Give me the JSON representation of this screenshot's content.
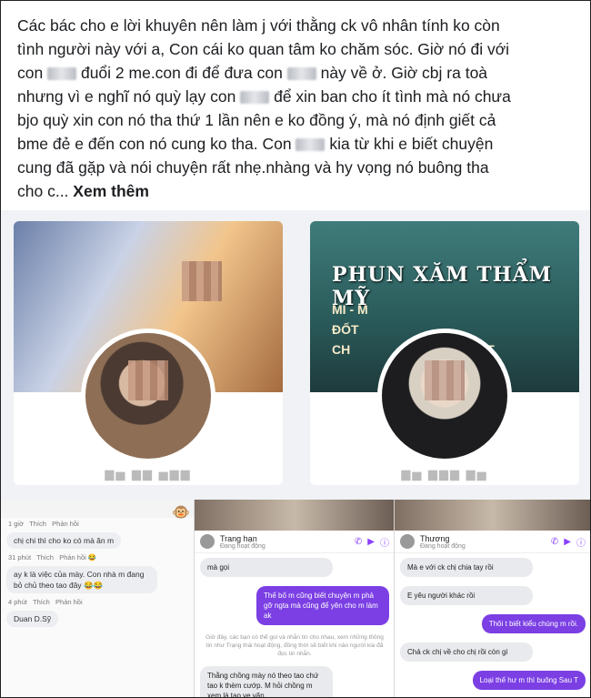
{
  "post": {
    "line1": "Các bác cho e lời khuyên nên làm j với thằng ck vô nhân tính ko còn",
    "line2": "tình người này với a, Con cái ko quan tâm ko chăm sóc. Giờ nó đi với",
    "line3a": "con",
    "line3b": "đuổi  2 me.con đi để đưa con",
    "line3c": "này về ở. Giờ cbj ra toà",
    "line4a": "nhưng vì e nghĩ nó quỳ lạy con",
    "line4b": "để xin ban cho ít tình mà nó chưa",
    "line5": "bjo quỳ xin con nó tha thứ 1 lần nên e ko đồng ý, mà nó định giết cả",
    "line6": "bme đẻ e đến con nó cung ko tha. Con",
    "line6b": "kia từ khi e biết chuyện",
    "line7": "cung đã gặp và nói chuyện rất nhẹ.nhàng và hy vọng nó buông tha",
    "line8": "cho c...",
    "more": "Xem thêm"
  },
  "cards": {
    "shop_title": "PHUN XĂM THẨM MỸ",
    "shop_line1": "MI - M",
    "shop_line2": "ĐỐT",
    "shop_line3": "CH",
    "shop_line3b": "T"
  },
  "shot1": {
    "c0_time": "1 giờ",
    "c0_like": "Thích",
    "c0_reply": "Phản hồi",
    "c1_text": "chị chi      thì cho ko có      mà ăn      m",
    "c1_time": "31 phút",
    "c1_like": "Thích",
    "c1_reply": "Phản hồi",
    "c2_text": "     ay k là việc của mày. Con      nhà m đang bỏ chủ theo tao đây 😂😂",
    "c2_time": "4 phút",
    "c2_like": "Thích",
    "c2_reply": "Phản hồi",
    "c3_name": "Duan D.Sỹ"
  },
  "shot2": {
    "head_name": "Trang hạn",
    "head_sub": "Đang hoạt động",
    "m0": "mà gọi",
    "m1": "Thế bố m cũng biết chuyện m phả gỡ ngta mà cũng để yên cho m làm ak",
    "sys": "Giờ đây, các bạn có thể gọi và nhắn tin cho nhau, xem những thông tin như Trạng thái hoạt động, đồng thời sẽ biết khi nào người kia đã đọc tin nhắn.",
    "m2": "Thằng chồng mày nó theo tao chứ tao k  thèm cướp. M hỏi chồng m xem là tao ve vãn"
  },
  "shot3": {
    "head_name": "Thương",
    "head_sub": "Đang hoạt động",
    "m1": "Mà e với ck chị chia tay rồi",
    "m2": "E yêu người khác rồi",
    "m3": "Thôi t biết kiểu chúng m rồi.",
    "m4": "Chả ck chị về cho chị rồi còn gì",
    "m5": "Loại thế      hư m thì buông Sau      T"
  }
}
